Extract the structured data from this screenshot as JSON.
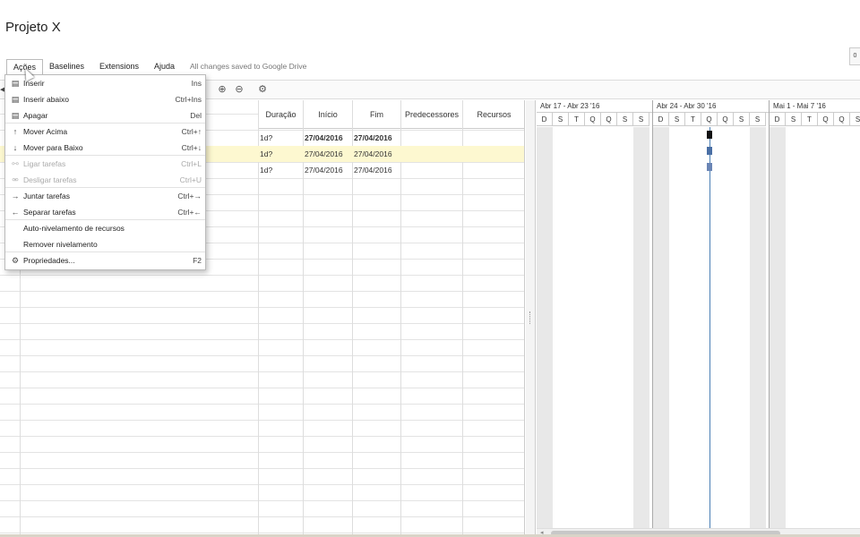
{
  "app": {
    "title": "Projeto X",
    "save_status": "All changes saved to Google Drive",
    "right_box_label": "0"
  },
  "menubar": {
    "items": [
      "Ações",
      "Baselines",
      "Extensions",
      "Ajuda"
    ]
  },
  "toolbar": {
    "icons": [
      "zoom-in-icon",
      "zoom-out-icon",
      "settings-icon"
    ]
  },
  "grid": {
    "columns": [
      "Duração",
      "Início",
      "Fim",
      "Predecessores",
      "Recursos"
    ],
    "rows": [
      {
        "duration": "1d?",
        "start": "27/04/2016",
        "end": "27/04/2016",
        "bold": true,
        "highlight": false
      },
      {
        "duration": "1d?",
        "start": "27/04/2016",
        "end": "27/04/2016",
        "bold": false,
        "highlight": true
      },
      {
        "duration": "1d?",
        "start": "27/04/2016",
        "end": "27/04/2016",
        "bold": false,
        "highlight": false
      }
    ]
  },
  "gantt": {
    "weeks": [
      "Abr 17 - Abr 23 '16",
      "Abr 24 - Abr 30 '16",
      "Mai 1 - Mai 7 '16"
    ],
    "days": [
      "D",
      "S",
      "T",
      "Q",
      "Q",
      "S",
      "S"
    ],
    "today_day_index": 10,
    "bar_colors": [
      "#111111",
      "#4a6fa5",
      "#6a85b5"
    ]
  },
  "dropdown": {
    "items": [
      {
        "icon": "insert-above-icon",
        "label": "Inserir",
        "shortcut": "Ins",
        "disabled": false
      },
      {
        "icon": "insert-below-icon",
        "label": "Inserir abaixo",
        "shortcut": "Ctrl+Ins",
        "disabled": false
      },
      {
        "icon": "delete-icon",
        "label": "Apagar",
        "shortcut": "Del",
        "disabled": false
      },
      {
        "icon": "arrow-up-icon",
        "label": "Mover Acima",
        "shortcut": "Ctrl+↑",
        "disabled": false
      },
      {
        "icon": "arrow-down-icon",
        "label": "Mover para Baixo",
        "shortcut": "Ctrl+↓",
        "disabled": false
      },
      {
        "icon": "link-icon",
        "label": "Ligar tarefas",
        "shortcut": "Ctrl+L",
        "disabled": true
      },
      {
        "icon": "unlink-icon",
        "label": "Desligar tarefas",
        "shortcut": "Ctrl+U",
        "disabled": true
      },
      {
        "icon": "arrow-right-icon",
        "label": "Juntar tarefas",
        "shortcut": "Ctrl+→",
        "disabled": false
      },
      {
        "icon": "arrow-left-icon",
        "label": "Separar tarefas",
        "shortcut": "Ctrl+←",
        "disabled": false
      },
      {
        "icon": "",
        "label": "Auto-nivelamento de recursos",
        "shortcut": "",
        "disabled": false
      },
      {
        "icon": "",
        "label": "Remover nivelamento",
        "shortcut": "",
        "disabled": false
      },
      {
        "icon": "properties-icon",
        "label": "Propriedades...",
        "shortcut": "F2",
        "disabled": false
      }
    ]
  }
}
